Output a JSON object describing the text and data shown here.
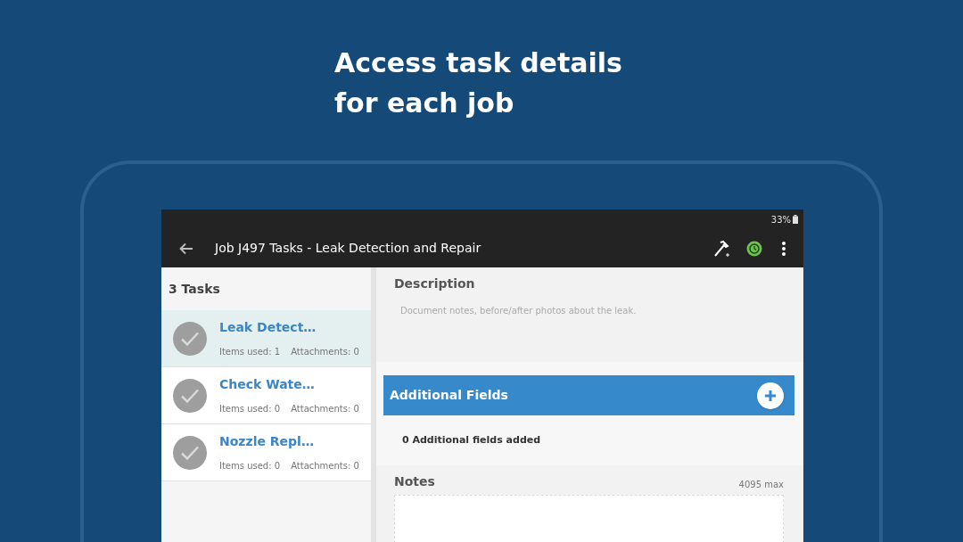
{
  "headline": [
    "Access task details",
    "for each job"
  ],
  "status_bar": {
    "battery": "33%"
  },
  "toolbar": {
    "title": "Job J497 Tasks - Leak Detection and Repair"
  },
  "task_list": {
    "heading": "3 Tasks",
    "tasks": [
      {
        "name": "Leak Detect…",
        "items_used": "Items used: 1",
        "attachments": "Attachments: 0",
        "selected": true
      },
      {
        "name": "Check Wate…",
        "items_used": "Items used: 0",
        "attachments": "Attachments: 0",
        "selected": false
      },
      {
        "name": "Nozzle Repl…",
        "items_used": "Items used: 0",
        "attachments": "Attachments: 0",
        "selected": false
      }
    ]
  },
  "detail": {
    "description_label": "Description",
    "description": "Document notes, before/after photos about the leak.",
    "additional_fields": {
      "title": "Additional Fields",
      "summary": "0 Additional fields added"
    },
    "notes": {
      "label": "Notes",
      "limit": "4095 max"
    }
  }
}
